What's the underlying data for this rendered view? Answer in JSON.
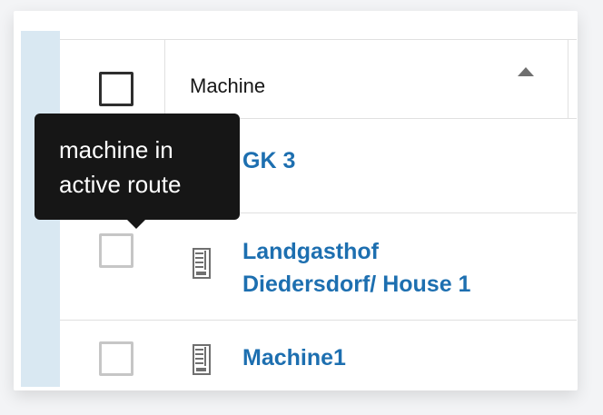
{
  "table": {
    "header": {
      "machine_label": "Machine"
    },
    "rows": [
      {
        "name": "GK 3"
      },
      {
        "name_line1": "Landgasthof",
        "name_line2": "Diedersdorf/ House 1"
      },
      {
        "name": "Machine1"
      }
    ]
  },
  "tooltip": {
    "line1": "machine in",
    "line2": "active route"
  },
  "colors": {
    "link": "#1d6fb0",
    "tooltip_bg": "#161616",
    "side_strip": "#d9e8f2"
  },
  "icons": {
    "sort": "caret-up-icon",
    "machine": "vending-machine-icon"
  }
}
